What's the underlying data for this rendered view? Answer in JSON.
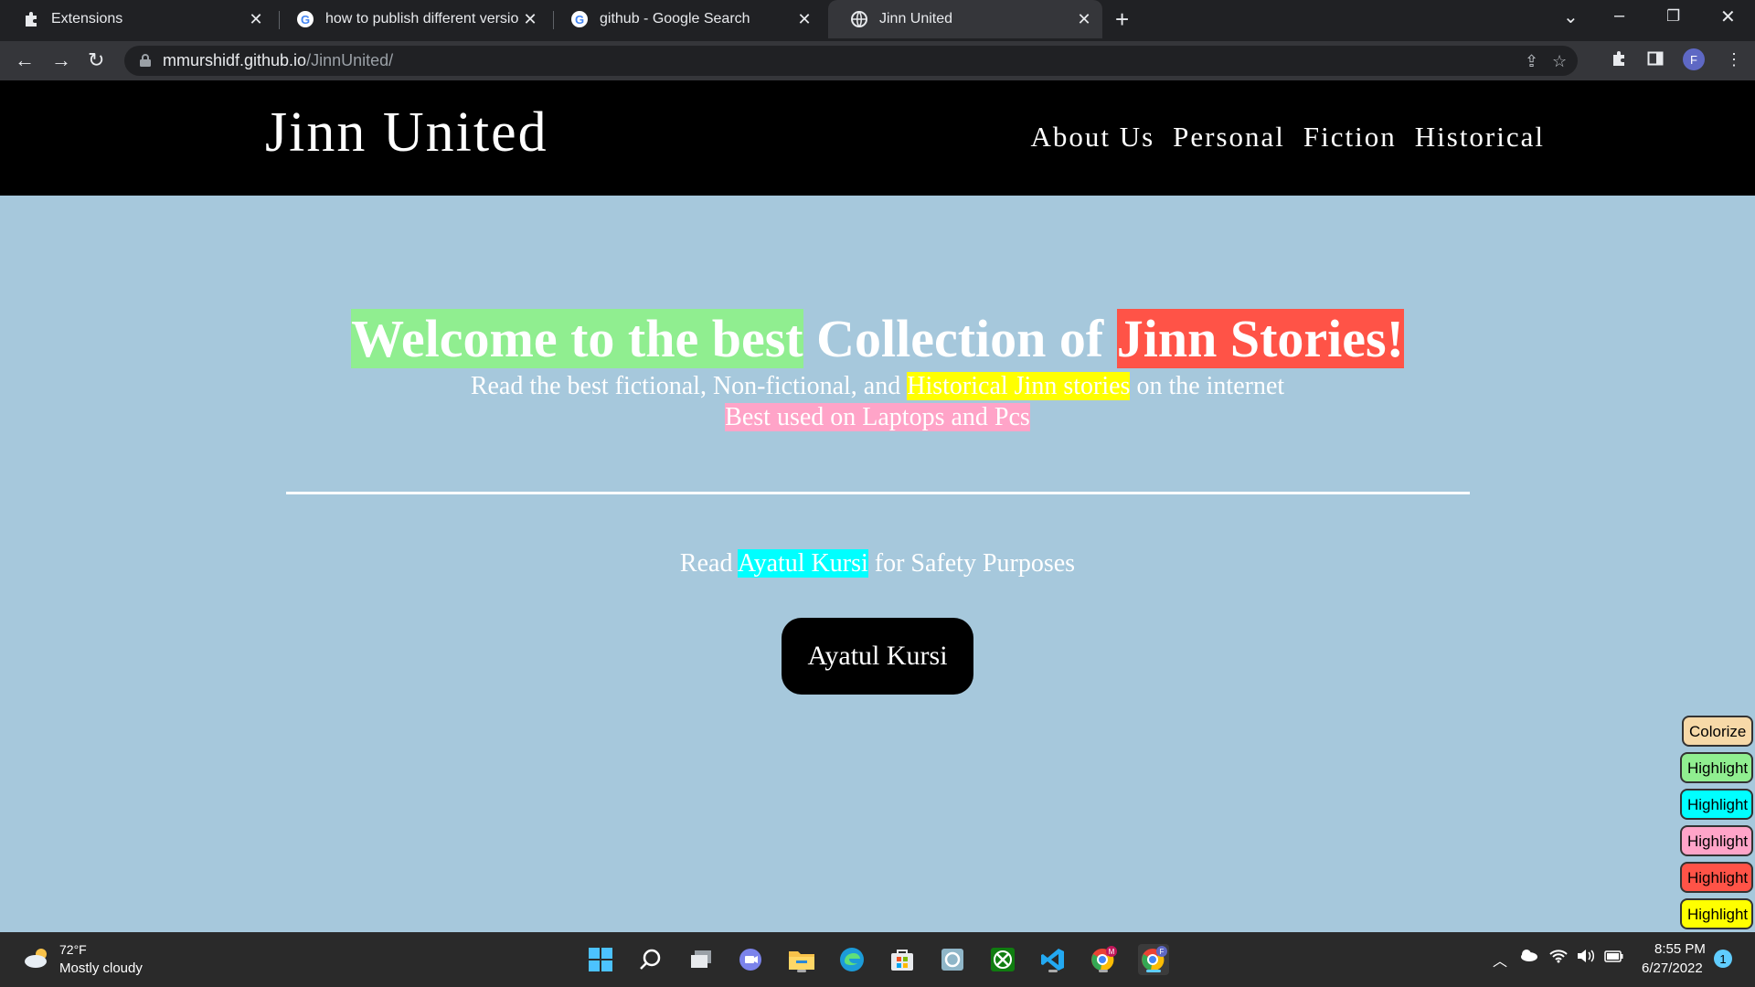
{
  "browser": {
    "tabs": [
      {
        "label": "Extensions",
        "icon": "puzzle-icon"
      },
      {
        "label": "how to publish different versions",
        "icon": "google-icon"
      },
      {
        "label": "github - Google Search",
        "icon": "google-icon"
      },
      {
        "label": "Jinn United",
        "icon": "globe-icon",
        "active": true
      }
    ],
    "url_host": "mmurshidf.github.io",
    "url_path": "/JinnUnited/",
    "profile_initial": "F"
  },
  "site": {
    "logo": "Jinn United",
    "nav": [
      "About Us",
      "Personal",
      "Fiction",
      "Historical"
    ],
    "headline": {
      "part1": "Welcome to the best",
      "part2": "Collection of",
      "part3": "Jinn Stories!"
    },
    "subline": {
      "part1": "Read the best fictional, Non-fictional, and",
      "part2": "Historical Jinn stories",
      "part3": "on the internet"
    },
    "note": "Best used on Laptops and Pcs",
    "read_line": {
      "part1": "Read",
      "part2": "Ayatul Kursi",
      "part3": "for Safety Purposes"
    },
    "button_label": "Ayatul Kursi"
  },
  "highlight_tools": [
    {
      "label": "Colorize",
      "color": "#f7d9a8"
    },
    {
      "label": "Highlight",
      "color": "#90ee90"
    },
    {
      "label": "Highlight",
      "color": "#00ffff"
    },
    {
      "label": "Highlight",
      "color": "#ffa4c8"
    },
    {
      "label": "Highlight",
      "color": "#ff5347"
    },
    {
      "label": "Highlight",
      "color": "#ffff00"
    }
  ],
  "taskbar": {
    "weather_temp": "72°F",
    "weather_desc": "Mostly cloudy",
    "time": "8:55 PM",
    "date": "6/27/2022",
    "notification_count": "1"
  }
}
